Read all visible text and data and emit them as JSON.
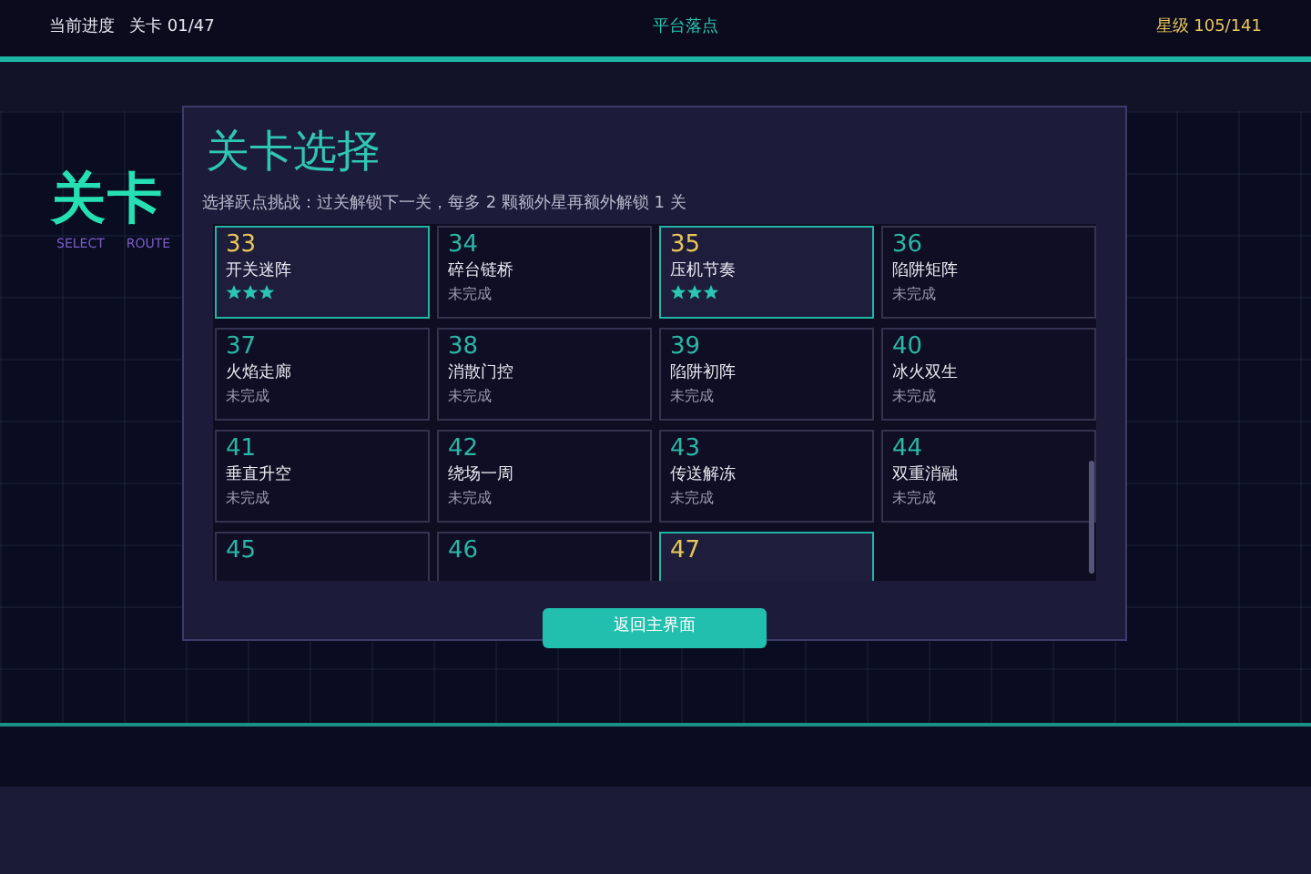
{
  "top_bar": {
    "progress_label": "当前进度",
    "level_counter": "关卡 01/47",
    "mode": "平台落点",
    "stars_counter": "星级 105/141"
  },
  "background": {
    "title": "关卡",
    "tags": [
      "SELECT",
      "ROUTE"
    ]
  },
  "dialog": {
    "title": "关卡选择",
    "subtitle": "选择跃点挑战：过关解锁下一关，每多 2 颗额外星再额外解锁 1 关",
    "levels": [
      {
        "number": "33",
        "name": "开关迷阵",
        "kind": "cleared",
        "stars": 3
      },
      {
        "number": "34",
        "name": "碎台链桥",
        "kind": "pending",
        "status": "未完成"
      },
      {
        "number": "35",
        "name": "压机节奏",
        "kind": "cleared",
        "stars": 3
      },
      {
        "number": "36",
        "name": "陷阱矩阵",
        "kind": "pending",
        "status": "未完成"
      },
      {
        "number": "37",
        "name": "火焰走廊",
        "kind": "pending",
        "status": "未完成"
      },
      {
        "number": "38",
        "name": "消散门控",
        "kind": "pending",
        "status": "未完成"
      },
      {
        "number": "39",
        "name": "陷阱初阵",
        "kind": "pending",
        "status": "未完成"
      },
      {
        "number": "40",
        "name": "冰火双生",
        "kind": "pending",
        "status": "未完成"
      },
      {
        "number": "41",
        "name": "垂直升空",
        "kind": "pending",
        "status": "未完成"
      },
      {
        "number": "42",
        "name": "绕场一周",
        "kind": "pending",
        "status": "未完成"
      },
      {
        "number": "43",
        "name": "传送解冻",
        "kind": "pending",
        "status": "未完成"
      },
      {
        "number": "44",
        "name": "双重消融",
        "kind": "pending",
        "status": "未完成"
      },
      {
        "number": "45",
        "kind": "pending"
      },
      {
        "number": "46",
        "kind": "pending"
      },
      {
        "number": "47",
        "kind": "current"
      }
    ],
    "button": "返回主界面"
  }
}
